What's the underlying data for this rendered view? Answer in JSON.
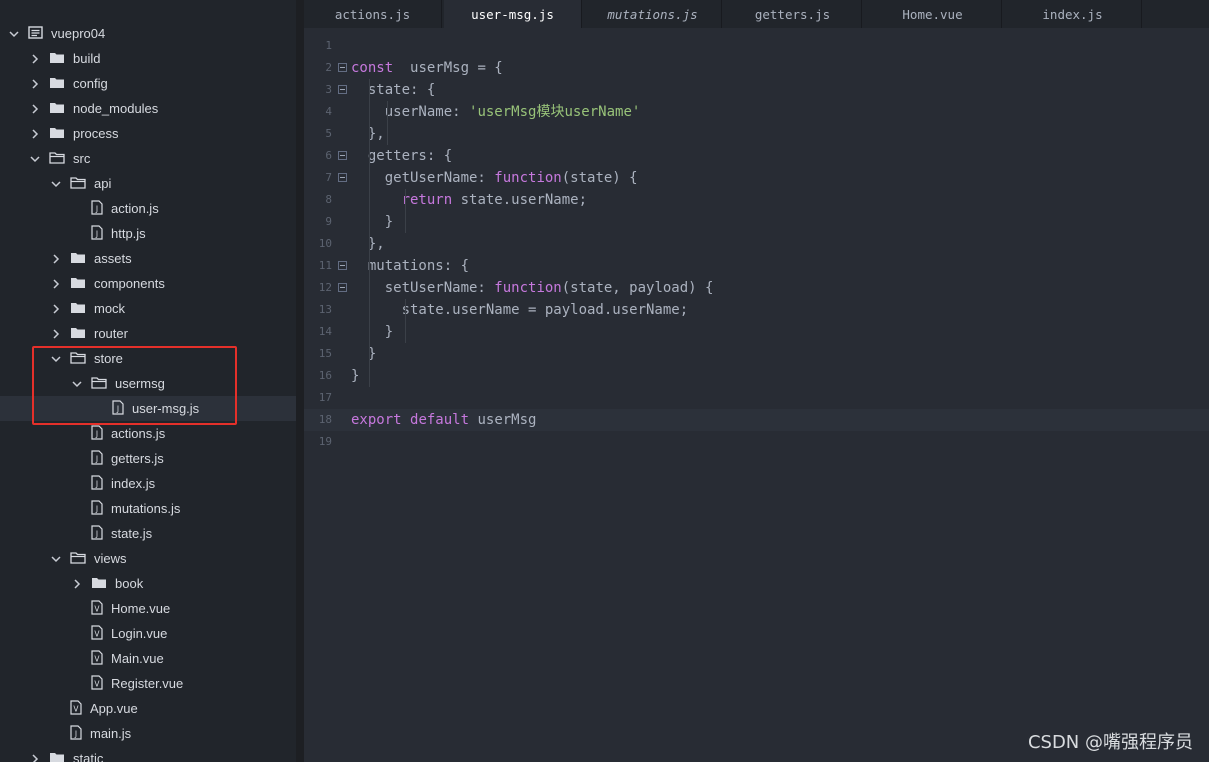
{
  "sidebar": {
    "rows": [
      {
        "label": "vuepro04",
        "type": "root",
        "depth": 0,
        "chevron": "down"
      },
      {
        "label": "build",
        "type": "folder",
        "depth": 1,
        "chevron": "right"
      },
      {
        "label": "config",
        "type": "folder",
        "depth": 1,
        "chevron": "right"
      },
      {
        "label": "node_modules",
        "type": "folder",
        "depth": 1,
        "chevron": "right"
      },
      {
        "label": "process",
        "type": "folder",
        "depth": 1,
        "chevron": "right"
      },
      {
        "label": "src",
        "type": "folder-open",
        "depth": 1,
        "chevron": "down"
      },
      {
        "label": "api",
        "type": "folder-open",
        "depth": 2,
        "chevron": "down"
      },
      {
        "label": "action.js",
        "type": "js",
        "depth": 3
      },
      {
        "label": "http.js",
        "type": "js",
        "depth": 3
      },
      {
        "label": "assets",
        "type": "folder",
        "depth": 2,
        "chevron": "right"
      },
      {
        "label": "components",
        "type": "folder",
        "depth": 2,
        "chevron": "right"
      },
      {
        "label": "mock",
        "type": "folder",
        "depth": 2,
        "chevron": "right"
      },
      {
        "label": "router",
        "type": "folder",
        "depth": 2,
        "chevron": "right"
      },
      {
        "label": "store",
        "type": "folder-open",
        "depth": 2,
        "chevron": "down"
      },
      {
        "label": "usermsg",
        "type": "folder-open",
        "depth": 3,
        "chevron": "down"
      },
      {
        "label": "user-msg.js",
        "type": "js",
        "depth": 4,
        "selected": true
      },
      {
        "label": "actions.js",
        "type": "js",
        "depth": 3
      },
      {
        "label": "getters.js",
        "type": "js",
        "depth": 3
      },
      {
        "label": "index.js",
        "type": "js",
        "depth": 3
      },
      {
        "label": "mutations.js",
        "type": "js",
        "depth": 3
      },
      {
        "label": "state.js",
        "type": "js",
        "depth": 3
      },
      {
        "label": "views",
        "type": "folder-open",
        "depth": 2,
        "chevron": "down"
      },
      {
        "label": "book",
        "type": "folder",
        "depth": 3,
        "chevron": "right"
      },
      {
        "label": "Home.vue",
        "type": "vue",
        "depth": 3
      },
      {
        "label": "Login.vue",
        "type": "vue",
        "depth": 3
      },
      {
        "label": "Main.vue",
        "type": "vue",
        "depth": 3
      },
      {
        "label": "Register.vue",
        "type": "vue",
        "depth": 3
      },
      {
        "label": "App.vue",
        "type": "vue",
        "depth": 2
      },
      {
        "label": "main.js",
        "type": "js",
        "depth": 2
      },
      {
        "label": "static",
        "type": "folder",
        "depth": 1,
        "chevron": "right"
      }
    ]
  },
  "tabs": [
    {
      "label": "actions.js",
      "active": false,
      "italic": false
    },
    {
      "label": "user-msg.js",
      "active": true,
      "italic": false
    },
    {
      "label": "mutations.js",
      "active": false,
      "italic": true
    },
    {
      "label": "getters.js",
      "active": false,
      "italic": false
    },
    {
      "label": "Home.vue",
      "active": false,
      "italic": false
    },
    {
      "label": "index.js",
      "active": false,
      "italic": false
    }
  ],
  "editor": {
    "current_line": 18,
    "lines": [
      {
        "n": "1",
        "fold": false,
        "tokens": []
      },
      {
        "n": "2",
        "fold": true,
        "tokens": [
          [
            "kw",
            "const"
          ],
          [
            "",
            "  userMsg = {"
          ]
        ]
      },
      {
        "n": "3",
        "fold": true,
        "tokens": [
          [
            "",
            "  state: {"
          ]
        ]
      },
      {
        "n": "4",
        "fold": false,
        "tokens": [
          [
            "",
            "    userName: "
          ],
          [
            "str",
            "'userMsg模块userName'"
          ]
        ]
      },
      {
        "n": "5",
        "fold": false,
        "tokens": [
          [
            "",
            "  },"
          ]
        ]
      },
      {
        "n": "6",
        "fold": true,
        "tokens": [
          [
            "",
            "  getters: {"
          ]
        ]
      },
      {
        "n": "7",
        "fold": true,
        "tokens": [
          [
            "",
            "    getUserName: "
          ],
          [
            "kw",
            "function"
          ],
          [
            "",
            "(state) {"
          ]
        ]
      },
      {
        "n": "8",
        "fold": false,
        "tokens": [
          [
            "",
            "      "
          ],
          [
            "kw",
            "return"
          ],
          [
            "",
            " state.userName;"
          ]
        ]
      },
      {
        "n": "9",
        "fold": false,
        "tokens": [
          [
            "",
            "    }"
          ]
        ]
      },
      {
        "n": "10",
        "fold": false,
        "tokens": [
          [
            "",
            "  },"
          ]
        ]
      },
      {
        "n": "11",
        "fold": true,
        "tokens": [
          [
            "",
            "  mutations: {"
          ]
        ]
      },
      {
        "n": "12",
        "fold": true,
        "tokens": [
          [
            "",
            "    setUserName: "
          ],
          [
            "kw",
            "function"
          ],
          [
            "",
            "(state, payload) {"
          ]
        ]
      },
      {
        "n": "13",
        "fold": false,
        "tokens": [
          [
            "",
            "      state.userName = payload.userName;"
          ]
        ]
      },
      {
        "n": "14",
        "fold": false,
        "tokens": [
          [
            "",
            "    }"
          ]
        ]
      },
      {
        "n": "15",
        "fold": false,
        "tokens": [
          [
            "",
            "  }"
          ]
        ]
      },
      {
        "n": "16",
        "fold": false,
        "tokens": [
          [
            "",
            "}"
          ]
        ]
      },
      {
        "n": "17",
        "fold": false,
        "tokens": []
      },
      {
        "n": "18",
        "fold": false,
        "tokens": [
          [
            "kw",
            "export"
          ],
          [
            "",
            " "
          ],
          [
            "kw",
            "default"
          ],
          [
            "",
            " userMsg"
          ]
        ]
      },
      {
        "n": "19",
        "fold": false,
        "tokens": []
      }
    ]
  },
  "watermark": "CSDN @嘴强程序员",
  "colors": {
    "highlight_box": "#e5302a",
    "keyword": "#c678dd",
    "string": "#98c379"
  }
}
